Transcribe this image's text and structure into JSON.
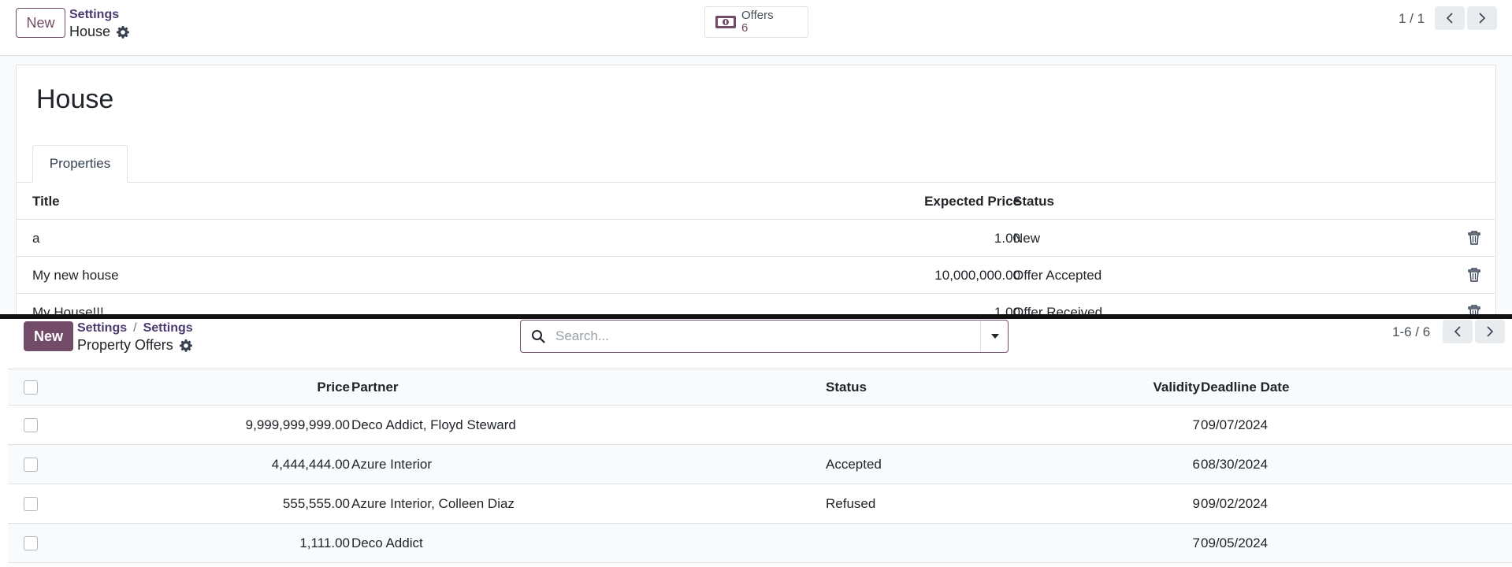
{
  "top": {
    "new_label": "New",
    "breadcrumb_parent": "Settings",
    "breadcrumb_current": "House",
    "stat_button": {
      "label": "Offers",
      "value": "6"
    },
    "pager": "1 / 1",
    "record_title": "House",
    "tab_label": "Properties",
    "columns": {
      "title": "Title",
      "expected_price": "Expected Price",
      "status": "Status"
    },
    "rows": [
      {
        "title": "a",
        "expected_price": "1.00",
        "status": "New"
      },
      {
        "title": "My new house",
        "expected_price": "10,000,000.00",
        "status": "Offer Accepted"
      },
      {
        "title": "My House!!!",
        "expected_price": "1.00",
        "status": "Offer Received"
      }
    ]
  },
  "bottom": {
    "new_label": "New",
    "breadcrumb": [
      "Settings",
      "Settings"
    ],
    "breadcrumb_separator": "/",
    "breadcrumb_current": "Property Offers",
    "search_placeholder": "Search...",
    "pager": "1-6 / 6",
    "columns": {
      "price": "Price",
      "partner": "Partner",
      "status": "Status",
      "validity": "Validity",
      "deadline": "Deadline Date"
    },
    "rows": [
      {
        "price": "9,999,999,999.00",
        "partner": "Deco Addict, Floyd Steward",
        "status": "",
        "validity": "7",
        "deadline": "09/07/2024"
      },
      {
        "price": "4,444,444.00",
        "partner": "Azure Interior",
        "status": "Accepted",
        "validity": "6",
        "deadline": "08/30/2024"
      },
      {
        "price": "555,555.00",
        "partner": "Azure Interior, Colleen Diaz",
        "status": "Refused",
        "validity": "9",
        "deadline": "09/02/2024"
      },
      {
        "price": "1,111.00",
        "partner": "Deco Addict",
        "status": "",
        "validity": "7",
        "deadline": "09/05/2024"
      }
    ]
  },
  "colors": {
    "primary": "#714b67",
    "border": "#dee2e6",
    "divider": "#111111"
  }
}
